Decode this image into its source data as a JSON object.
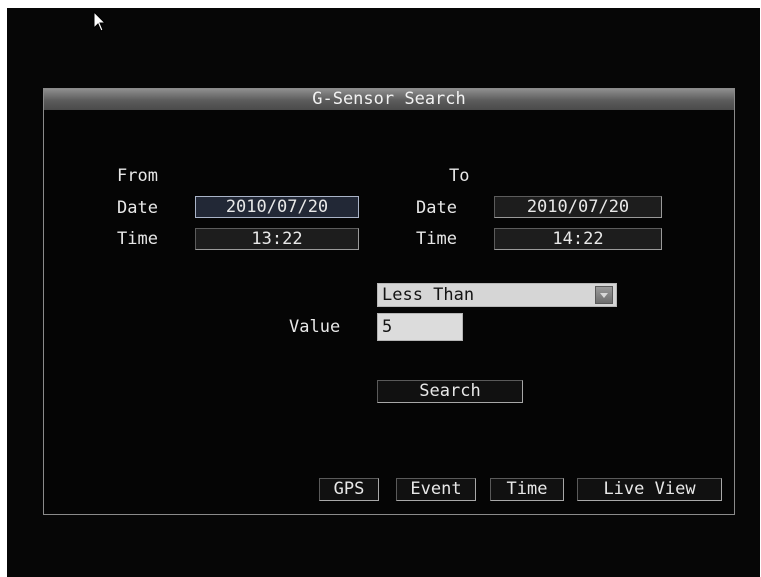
{
  "window": {
    "title": "G-Sensor Search"
  },
  "from": {
    "heading": "From",
    "date_label": "Date",
    "date_value": "2010/07/20",
    "time_label": "Time",
    "time_value": "13:22"
  },
  "to": {
    "heading": "To",
    "date_label": "Date",
    "date_value": "2010/07/20",
    "time_label": "Time",
    "time_value": "14:22"
  },
  "filter": {
    "condition_selected": "Less Than",
    "value_label": "Value",
    "value": "5"
  },
  "actions": {
    "search_label": "Search"
  },
  "bottom_nav": {
    "gps_label": "GPS",
    "event_label": "Event",
    "time_label": "Time",
    "live_view_label": "Live View"
  },
  "icons": {
    "cursor": "mouse-pointer-icon",
    "dropdown": "dropdown-arrow-icon"
  },
  "colors": {
    "background": "#060606",
    "titlebar": "#6e6e6e",
    "input_background": "#dcdcdc",
    "selected_border": "#aab4c8"
  }
}
